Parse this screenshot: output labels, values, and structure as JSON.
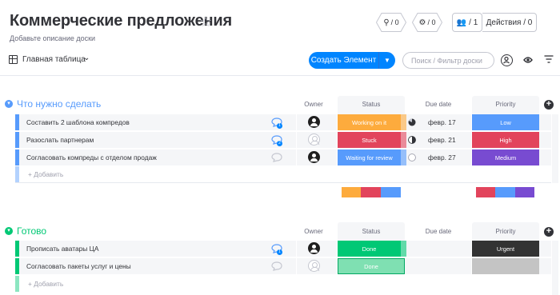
{
  "header": {
    "title": "Коммерческие предложения",
    "subtitle": "Добавьте описание доски",
    "integrations_count": "/ 0",
    "automations_count": "/ 0",
    "members_count": "/ 1",
    "activity_label": "Действия / 0"
  },
  "toolbar": {
    "view_label": "Главная таблица",
    "create_label": "Создать Элемент",
    "search_placeholder": "Поиск / Фильтр доски"
  },
  "colors": {
    "blue_group": "#579bfc",
    "green_group": "#00c875",
    "working_on_it": "#fdab3d",
    "stuck": "#e2445c",
    "waiting": "#579bfc",
    "done": "#00c875",
    "done_light": "#7fe0b2",
    "low": "#579bfc",
    "high": "#e2445c",
    "medium": "#784bd1",
    "urgent": "#333333"
  },
  "groups": [
    {
      "title": "Что нужно сделать",
      "columns": {
        "owner": "Owner",
        "status": "Status",
        "due": "Due date",
        "priority": "Priority"
      },
      "items": [
        {
          "name": "Составить 2 шаблона компредов",
          "updates": "1",
          "status": "Working on it",
          "due": "февр. 17",
          "priority": "Low"
        },
        {
          "name": "Разослать партнерам",
          "updates": "2",
          "status": "Stuck",
          "due": "февр. 21",
          "priority": "High"
        },
        {
          "name": "Согласовать компреды с отделом продаж",
          "updates": "",
          "status": "Waiting for review",
          "due": "февр. 27",
          "priority": "Medium"
        }
      ],
      "add_label": "+ Добавить"
    },
    {
      "title": "Готово",
      "columns": {
        "owner": "Owner",
        "status": "Status",
        "due": "Due date",
        "priority": "Priority"
      },
      "items": [
        {
          "name": "Прописать аватары ЦА",
          "updates": "1",
          "status": "Done",
          "due": "",
          "priority": "Urgent"
        },
        {
          "name": "Согласовать пакеты услуг и цены",
          "updates": "",
          "status": "Done",
          "due": "",
          "priority": ""
        }
      ],
      "add_label": "+ Добавить"
    }
  ]
}
